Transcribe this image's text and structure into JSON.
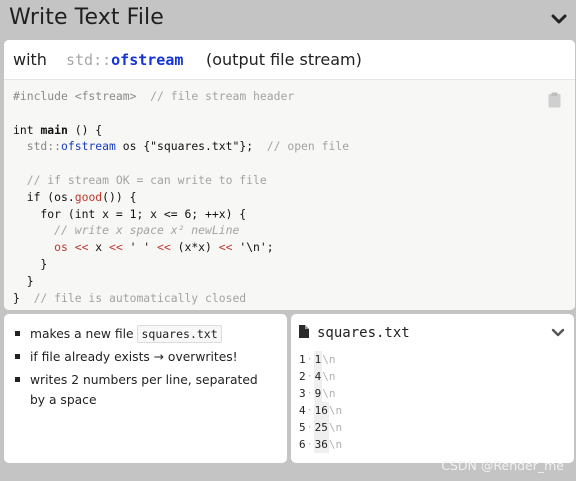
{
  "header": {
    "title": "Write Text File",
    "collapse_icon": "chevron-down-icon"
  },
  "headline": {
    "prefix": "with",
    "namespace": "std::",
    "class_name": "ofstream",
    "suffix": "(output file stream)"
  },
  "code": {
    "copy_icon": "clipboard-icon",
    "lines": [
      [
        {
          "t": "#include <fstream>",
          "k": "pp"
        },
        {
          "t": "  // file stream header",
          "k": "cm"
        }
      ],
      [],
      [
        {
          "t": "int ",
          "k": "kw"
        },
        {
          "t": "main",
          "k": "fn"
        },
        {
          "t": " () {",
          "k": "kw"
        }
      ],
      [
        {
          "t": "  ",
          "k": "kw"
        },
        {
          "t": "std::",
          "k": "ns"
        },
        {
          "t": "ofstream",
          "k": "cls"
        },
        {
          "t": " os {\"squares.txt\"};",
          "k": "kw"
        },
        {
          "t": "  // open file",
          "k": "cm"
        }
      ],
      [],
      [
        {
          "t": "  // if stream OK = can write to file",
          "k": "cm"
        }
      ],
      [
        {
          "t": "  if (os.",
          "k": "kw"
        },
        {
          "t": "good",
          "k": "red"
        },
        {
          "t": "()) {",
          "k": "kw"
        }
      ],
      [
        {
          "t": "    for (int x = 1; x <= 6; ++x) {",
          "k": "kw"
        }
      ],
      [
        {
          "t": "      // write x space x² newLine",
          "k": "it"
        }
      ],
      [
        {
          "t": "      os << ",
          "k": "red"
        },
        {
          "t": "x ",
          "k": "kw"
        },
        {
          "t": "<<",
          "k": "red"
        },
        {
          "t": " ' ' ",
          "k": "kw"
        },
        {
          "t": "<<",
          "k": "red"
        },
        {
          "t": " (x*x) ",
          "k": "kw"
        },
        {
          "t": "<<",
          "k": "red"
        },
        {
          "t": " '\\n';",
          "k": "kw"
        }
      ],
      [
        {
          "t": "    }",
          "k": "kw"
        }
      ],
      [
        {
          "t": "  }",
          "k": "kw"
        }
      ],
      [
        {
          "t": "}",
          "k": "kw"
        },
        {
          "t": "  // file is automatically closed",
          "k": "cm"
        }
      ]
    ]
  },
  "notes": {
    "items": [
      {
        "before": "makes a new file ",
        "code": "squares.txt",
        "after": ""
      },
      {
        "before": "if file already exists → overwrites!",
        "code": "",
        "after": ""
      },
      {
        "before": "writes 2 numbers per line, separated by a space",
        "code": "",
        "after": ""
      }
    ]
  },
  "file": {
    "icon": "file-icon",
    "name": "squares.txt",
    "expand_icon": "chevron-down-icon",
    "space_marker": "·",
    "newline_marker": "\\n",
    "rows": [
      {
        "a": "1",
        "b": "1"
      },
      {
        "a": "2",
        "b": "4"
      },
      {
        "a": "3",
        "b": "9"
      },
      {
        "a": "4",
        "b": "16"
      },
      {
        "a": "5",
        "b": "25"
      },
      {
        "a": "6",
        "b": "36"
      }
    ]
  },
  "watermark": "CSDN @Render_me"
}
